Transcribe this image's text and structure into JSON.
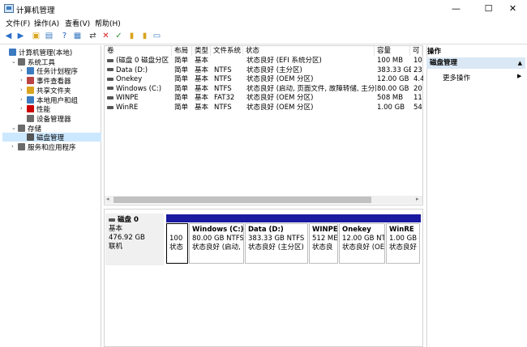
{
  "window": {
    "title": "计算机管理",
    "minimize": "—",
    "maximize": "☐",
    "close": "✕"
  },
  "menu": [
    "文件(F)",
    "操作(A)",
    "查看(V)",
    "帮助(H)"
  ],
  "tree": [
    {
      "label": "计算机管理(本地)",
      "indent": 0,
      "arrow": ""
    },
    {
      "label": "系统工具",
      "indent": 1,
      "arrow": "v"
    },
    {
      "label": "任务计划程序",
      "indent": 2,
      "arrow": ">"
    },
    {
      "label": "事件查看器",
      "indent": 2,
      "arrow": ">"
    },
    {
      "label": "共享文件夹",
      "indent": 2,
      "arrow": ">"
    },
    {
      "label": "本地用户和组",
      "indent": 2,
      "arrow": ">"
    },
    {
      "label": "性能",
      "indent": 2,
      "arrow": ">"
    },
    {
      "label": "设备管理器",
      "indent": 2,
      "arrow": ""
    },
    {
      "label": "存储",
      "indent": 1,
      "arrow": "v"
    },
    {
      "label": "磁盘管理",
      "indent": 2,
      "arrow": ""
    },
    {
      "label": "服务和应用程序",
      "indent": 1,
      "arrow": ">"
    }
  ],
  "columns": [
    "卷",
    "布局",
    "类型",
    "文件系统",
    "状态",
    "容量",
    "可"
  ],
  "volumes": [
    {
      "name": "(磁盘 0 磁盘分区 1)",
      "layout": "简单",
      "type": "基本",
      "fs": "",
      "status": "状态良好 (EFI 系统分区)",
      "capacity": "100 MB",
      "free": "10"
    },
    {
      "name": "Data (D:)",
      "layout": "简单",
      "type": "基本",
      "fs": "NTFS",
      "status": "状态良好 (主分区)",
      "capacity": "383.33 GB",
      "free": "23"
    },
    {
      "name": "Onekey",
      "layout": "简单",
      "type": "基本",
      "fs": "NTFS",
      "status": "状态良好 (OEM 分区)",
      "capacity": "12.00 GB",
      "free": "4.4"
    },
    {
      "name": "Windows (C:)",
      "layout": "简单",
      "type": "基本",
      "fs": "NTFS",
      "status": "状态良好 (启动, 页面文件, 故障转储, 主分区)",
      "capacity": "80.00 GB",
      "free": "20"
    },
    {
      "name": "WINPE",
      "layout": "简单",
      "type": "基本",
      "fs": "FAT32",
      "status": "状态良好 (OEM 分区)",
      "capacity": "508 MB",
      "free": "11"
    },
    {
      "name": "WinRE",
      "layout": "简单",
      "type": "基本",
      "fs": "NTFS",
      "status": "状态良好 (OEM 分区)",
      "capacity": "1.00 GB",
      "free": "54"
    }
  ],
  "disk": {
    "name": "磁盘 0",
    "type": "基本",
    "size": "476.92 GB",
    "status": "联机"
  },
  "partitions": [
    {
      "title": "",
      "line1": "100",
      "line2": "状态"
    },
    {
      "title": "Windows  (C:)",
      "line1": "80.00 GB NTFS",
      "line2": "状态良好 (启动, 页"
    },
    {
      "title": "Data  (D:)",
      "line1": "383.33 GB NTFS",
      "line2": "状态良好 (主分区)"
    },
    {
      "title": "WINPE",
      "line1": "512 ME",
      "line2": "状态良"
    },
    {
      "title": "Onekey",
      "line1": "12.00 GB NT",
      "line2": "状态良好 (OE"
    },
    {
      "title": "WinRE",
      "line1": "1.00 GB N",
      "line2": "状态良好"
    }
  ],
  "actions": {
    "title": "操作",
    "section": "磁盘管理",
    "more": "更多操作"
  }
}
